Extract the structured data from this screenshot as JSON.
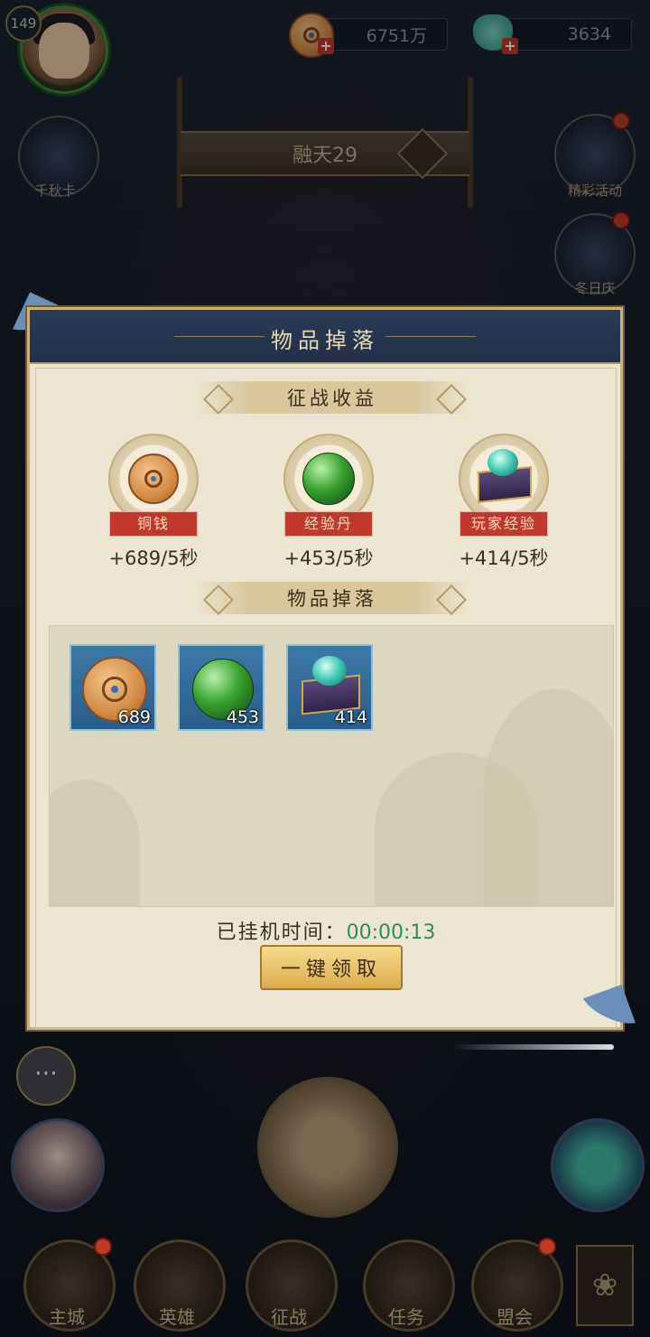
{
  "hud": {
    "level": "149",
    "copper_amount": "6751万",
    "jade_amount": "3634"
  },
  "side_left": {
    "label": "千秋卡"
  },
  "side_right": [
    {
      "label": "精彩活动"
    },
    {
      "label": "冬日庆"
    }
  ],
  "search": {
    "text": "融天29"
  },
  "modal": {
    "title": "物品掉落",
    "section_income": "征战收益",
    "section_drops": "物品掉落",
    "income": [
      {
        "name": "铜钱",
        "rate": "+689/5秒",
        "icon": "copper-coin"
      },
      {
        "name": "经验丹",
        "rate": "+453/5秒",
        "icon": "green-orb"
      },
      {
        "name": "玩家经验",
        "rate": "+414/5秒",
        "icon": "jade-box"
      }
    ],
    "drops": [
      {
        "count": "689",
        "icon": "copper-coin"
      },
      {
        "count": "453",
        "icon": "green-orb"
      },
      {
        "count": "414",
        "icon": "jade-box"
      }
    ],
    "idle_label": "已挂机时间：",
    "idle_time": "00:00:13",
    "claim_button": "一键领取"
  },
  "bottom_nav": [
    {
      "label": "主城"
    },
    {
      "label": "英雄"
    },
    {
      "label": "征战"
    },
    {
      "label": "任务"
    },
    {
      "label": "盟会"
    }
  ],
  "colors": {
    "modal_bg": "#ece5d2",
    "header_bg": "#2b3a57",
    "tag_red": "#c0392b",
    "timer_green": "#2f8a5e",
    "slot_blue": "#3d79a8"
  }
}
